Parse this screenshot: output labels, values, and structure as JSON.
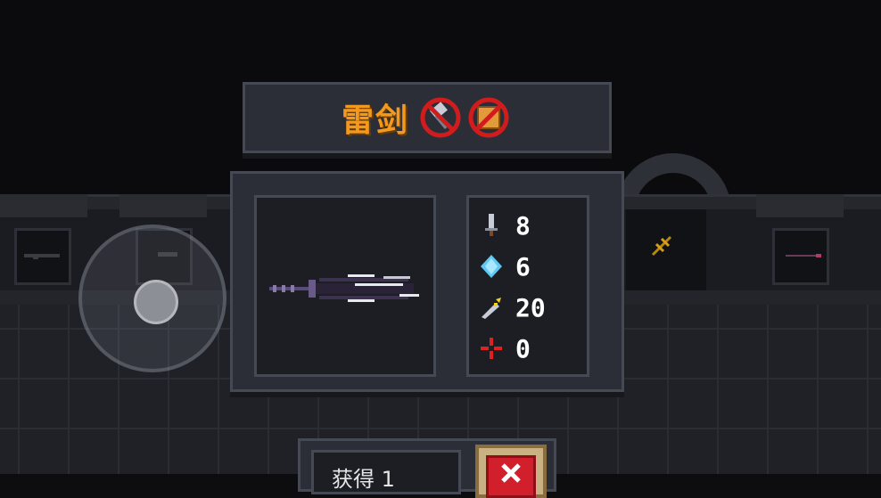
{
  "weapon": {
    "name": "雷剑",
    "restriction_badges": [
      "no-hammer-icon",
      "no-crate-icon"
    ]
  },
  "stats": [
    {
      "icon": "damage-sword-icon",
      "value": "8"
    },
    {
      "icon": "energy-diamond-icon",
      "value": "6"
    },
    {
      "icon": "crit-dagger-icon",
      "value": "20"
    },
    {
      "icon": "accuracy-crosshair-icon",
      "value": "0"
    }
  ],
  "bottom": {
    "obtain_label": "获得 1",
    "close_icon": "close-x-icon"
  },
  "colors": {
    "title": "#f39a1e",
    "panel": "#2b2e36",
    "panel_border": "#454953",
    "close_button": "#d1202b"
  }
}
